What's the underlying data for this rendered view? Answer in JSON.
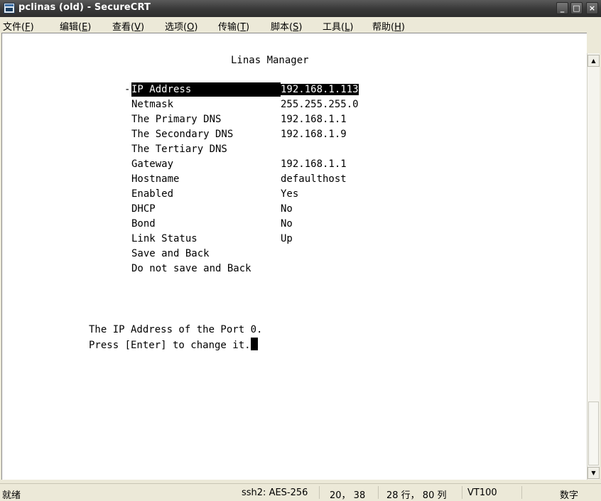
{
  "window": {
    "title": "pclinas (old) - SecureCRT",
    "buttons": {
      "minimize": "_",
      "maximize": "□",
      "close": "×"
    }
  },
  "menu": [
    {
      "label": "文件(",
      "accel": "F",
      "tail": ")"
    },
    {
      "label": "编辑(",
      "accel": "E",
      "tail": ")"
    },
    {
      "label": "查看(",
      "accel": "V",
      "tail": ")"
    },
    {
      "label": "选项(",
      "accel": "O",
      "tail": ")"
    },
    {
      "label": "传输(",
      "accel": "T",
      "tail": ")"
    },
    {
      "label": "脚本(",
      "accel": "S",
      "tail": ")"
    },
    {
      "label": "工具(",
      "accel": "L",
      "tail": ")"
    },
    {
      "label": "帮助(",
      "accel": "H",
      "tail": ")"
    }
  ],
  "terminal": {
    "header": "Linas Manager",
    "selected_marker": "-",
    "fields": [
      {
        "label": "IP Address",
        "value": "192.168.1.113"
      },
      {
        "label": "Netmask",
        "value": "255.255.255.0"
      },
      {
        "label": "The Primary DNS",
        "value": "192.168.1.1"
      },
      {
        "label": "The Secondary DNS",
        "value": "192.168.1.9"
      },
      {
        "label": "The Tertiary DNS",
        "value": ""
      },
      {
        "label": "Gateway",
        "value": "192.168.1.1"
      },
      {
        "label": "Hostname",
        "value": "defaulthost"
      },
      {
        "label": "Enabled",
        "value": "Yes"
      },
      {
        "label": "DHCP",
        "value": "No"
      },
      {
        "label": "Bond",
        "value": "No"
      },
      {
        "label": "Link Status",
        "value": "Up"
      },
      {
        "label": "Save and Back",
        "value": ""
      },
      {
        "label": "Do not save and Back",
        "value": ""
      }
    ],
    "message_line1": "The IP Address of the Port 0.",
    "message_line2": "Press [Enter] to change it."
  },
  "scrollbar": {
    "up_arrow": "▲",
    "down_arrow": "▼"
  },
  "status": {
    "ready": "就绪",
    "cipher": "ssh2: AES-256",
    "cursor_pos": "20， 38",
    "dimensions": "28 行， 80 列",
    "emulation": "VT100",
    "numlock": "数字"
  }
}
